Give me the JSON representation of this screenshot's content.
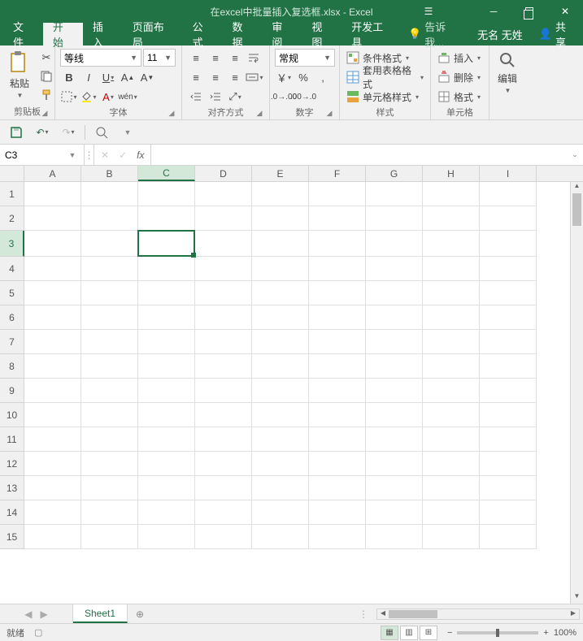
{
  "title": "在excel中批量插入复选框.xlsx - Excel",
  "tabs": {
    "file": "文件",
    "home": "开始",
    "insert": "插入",
    "layout": "页面布局",
    "formulas": "公式",
    "data": "数据",
    "review": "审阅",
    "view": "视图",
    "developer": "开发工具",
    "tellme": "告诉我...",
    "account": "无名 无姓",
    "share": "共享"
  },
  "ribbon": {
    "clipboard": {
      "paste": "粘贴",
      "label": "剪贴板"
    },
    "font": {
      "name": "等线",
      "size": "11",
      "label": "字体"
    },
    "align": {
      "label": "对齐方式"
    },
    "number": {
      "format": "常规",
      "label": "数字"
    },
    "styles": {
      "cond": "条件格式",
      "table": "套用表格格式",
      "cell": "单元格样式",
      "label": "样式"
    },
    "cells": {
      "insert": "插入",
      "delete": "删除",
      "format": "格式",
      "label": "单元格"
    },
    "editing": {
      "label": "编辑"
    }
  },
  "namebox": "C3",
  "columns": [
    "A",
    "B",
    "C",
    "D",
    "E",
    "F",
    "G",
    "H",
    "I"
  ],
  "rows": [
    "1",
    "2",
    "3",
    "4",
    "5",
    "6",
    "7",
    "8",
    "9",
    "10",
    "11",
    "12",
    "13",
    "14",
    "15"
  ],
  "selected": {
    "col": "C",
    "row": "3"
  },
  "sheet": "Sheet1",
  "status": {
    "ready": "就绪",
    "zoom": "100%"
  }
}
